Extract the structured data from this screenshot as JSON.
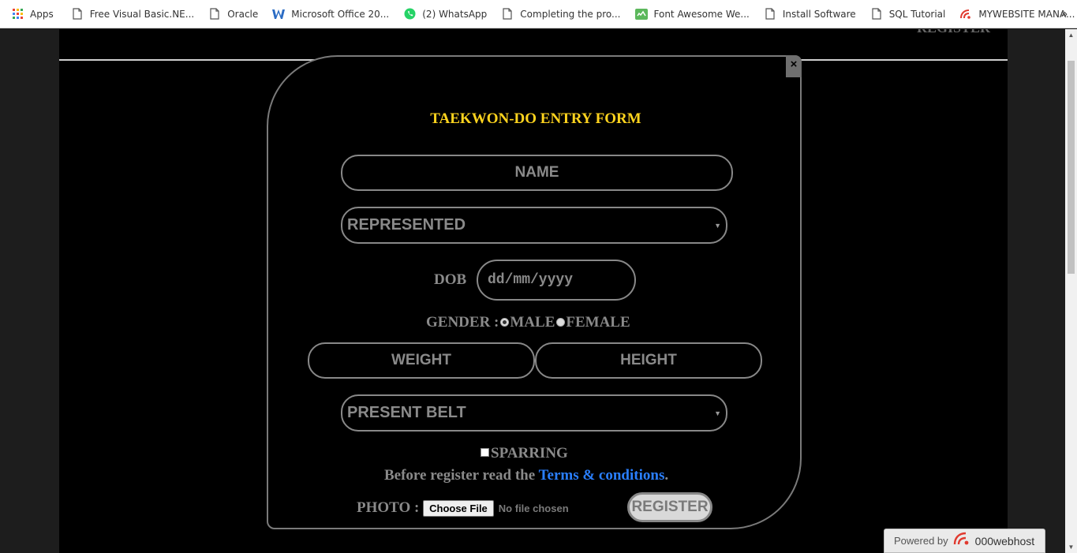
{
  "bookmarks": {
    "items": [
      {
        "label": "Apps",
        "icon": "apps-grid-icon"
      },
      {
        "label": "Free Visual Basic.NE...",
        "icon": "page-icon"
      },
      {
        "label": "Oracle",
        "icon": "page-icon"
      },
      {
        "label": "Microsoft Office 20...",
        "icon": "w-logo-icon"
      },
      {
        "label": "(2) WhatsApp",
        "icon": "whatsapp-icon"
      },
      {
        "label": "Completing the pro...",
        "icon": "page-icon"
      },
      {
        "label": "Font Awesome We...",
        "icon": "font-awesome-icon"
      },
      {
        "label": "Install Software",
        "icon": "page-icon"
      },
      {
        "label": "SQL Tutorial",
        "icon": "page-icon"
      },
      {
        "label": "MYWEBSITE MANA...",
        "icon": "webhost-icon"
      }
    ],
    "more": "»"
  },
  "page": {
    "heading_fragment": "REGISTER"
  },
  "modal": {
    "close": "×",
    "title": "TAEKWON-DO ENTRY FORM",
    "name_placeholder": "NAME",
    "represented_label": "REPRESENTED",
    "dob_label": "DOB",
    "dob_placeholder": "dd/mm/yyyy",
    "gender_label": "GENDER :",
    "gender_male": "MALE",
    "gender_female": "FEMALE",
    "weight_placeholder": "WEIGHT",
    "height_placeholder": "HEIGHT",
    "belt_label": "PRESENT BELT",
    "sparring_label": "SPARRING",
    "terms_prefix": "Before register read the ",
    "terms_link": "Terms & conditions",
    "terms_suffix": ".",
    "photo_label": "PHOTO :",
    "choose_file": "Choose File",
    "file_status": "No file chosen",
    "register": "REGISTER"
  },
  "powered": {
    "prefix": "Powered by",
    "brand": "000webhost"
  },
  "colors": {
    "title": "#ffd41e",
    "link": "#2a7fff",
    "field_text": "#8a8a8a",
    "page_bg": "#000000"
  }
}
